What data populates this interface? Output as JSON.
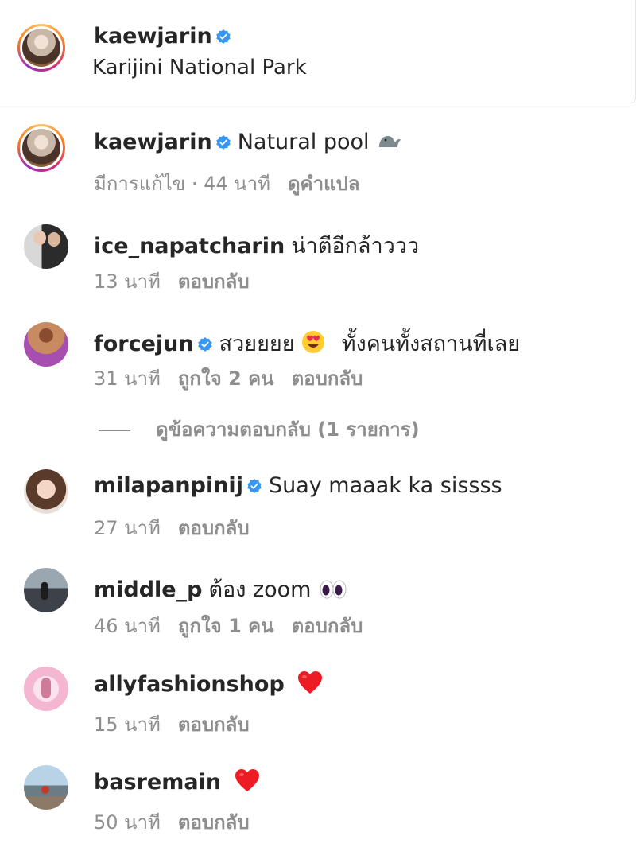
{
  "post": {
    "author": "kaewjarin",
    "location": "Karijini National Park"
  },
  "comments": [
    {
      "user": "kaewjarin",
      "text": "Natural pool",
      "emoji": "seal-emoji",
      "meta": "มีการแก้ไข · 44 นาที",
      "action": "ดูคำแปล"
    },
    {
      "user": "ice_napatcharin",
      "text": "น่าตีอีกล้าววว",
      "meta": "13 นาที",
      "action": "ตอบกลับ"
    },
    {
      "user": "forcejun",
      "text": "สวยยยย",
      "emoji": "heart-eyes-emoji",
      "text2": "ทั้งคนทั้งสถานที่เลย",
      "meta": "31 นาที",
      "likes": "ถูกใจ 2 คน",
      "action": "ตอบกลับ"
    },
    {
      "user": "milapanpinij",
      "text": "Suay maaak ka sissss",
      "meta": "27 นาที",
      "action": "ตอบกลับ"
    },
    {
      "user": "middle_p",
      "text": "ต้อง zoom",
      "emoji": "eyes-emoji",
      "meta": "46 นาที",
      "likes": "ถูกใจ 1 คน",
      "action": "ตอบกลับ"
    },
    {
      "user": "allyfashionshop",
      "emoji": "red-heart-emoji",
      "meta": "15 นาที",
      "action": "ตอบกลับ"
    },
    {
      "user": "basremain",
      "emoji": "red-heart-emoji",
      "meta": "50 นาที",
      "action": "ตอบกลับ"
    }
  ],
  "view_replies": "ดูข้อความตอบกลับ (1 รายการ)",
  "colors": {
    "verified": "#3897f0",
    "secondary_text": "#8e8e8e",
    "heart": "#ed1c24"
  }
}
